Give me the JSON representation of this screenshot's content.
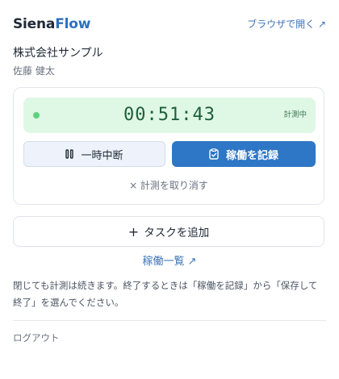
{
  "app": {
    "logo_part1": "Siena",
    "logo_part2": "Flow",
    "open_in_browser": "ブラウザで開く ↗"
  },
  "account": {
    "company": "株式会社サンプル",
    "user": "佐藤 健太"
  },
  "timer": {
    "elapsed": "00:51:43",
    "status": "計測中",
    "status_color": "#5fd07f"
  },
  "actions": {
    "pause_label": "一時中断",
    "record_label": "稼働を記録",
    "cancel_label": "× 計測を取り消す",
    "add_task_label": "タスクを追加",
    "work_list_label": "稼働一覧 ↗"
  },
  "note": "閉じても計測は続きます。終了するときは「稼働を記録」から「保存して終了」を選んでください。",
  "logout_label": "ログアウト",
  "colors": {
    "brand": "#2f6fbd",
    "primary_button": "#2e76c6",
    "timer_bg": "#dff7e5"
  },
  "icons": {
    "pause": "pause-icon",
    "record": "clipboard-check-icon",
    "add": "plus-icon"
  }
}
